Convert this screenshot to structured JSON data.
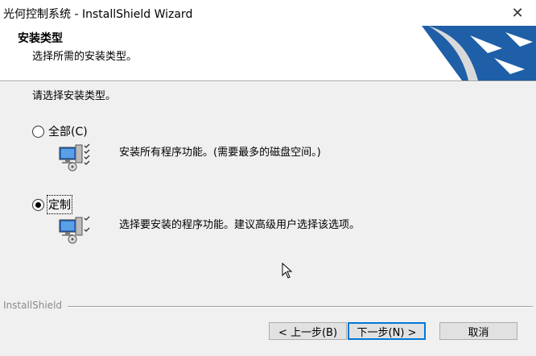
{
  "window": {
    "title": "光何控制系统 - InstallShield Wizard",
    "close_glyph": "✕"
  },
  "header": {
    "title": "安装类型",
    "subtitle": "选择所需的安装类型。"
  },
  "prompt": "请选择安装类型。",
  "options": [
    {
      "label": "全部(C)",
      "description": "安装所有程序功能。(需要最多的磁盘空间。)",
      "selected": false
    },
    {
      "label": "定制",
      "description": "选择要安装的程序功能。建议高级用户选择该选项。",
      "selected": true
    }
  ],
  "footer": {
    "brand": "InstallShield",
    "back_label": "< 上一步(B)",
    "next_label": "下一步(N) >",
    "cancel_label": "取消"
  },
  "colors": {
    "banner_blue": "#1f5fa8",
    "default_button_border": "#0078d7"
  }
}
